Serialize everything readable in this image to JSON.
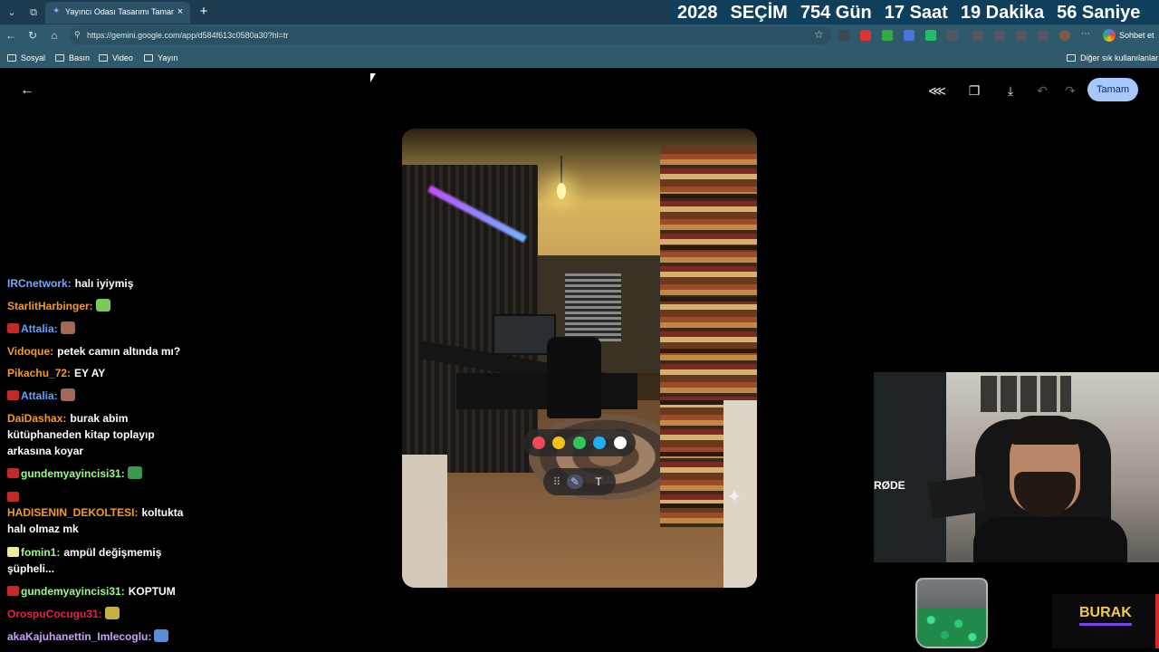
{
  "browser": {
    "tab_title": "Yayıncı Odası Tasarımı Tamamlandı",
    "url": "https://gemini.google.com/app/d584f613c0580a30?hl=tr",
    "chat_button_label": "Sohbet et",
    "bookmarks": [
      "Sosyal",
      "Basın",
      "Video",
      "Yayın"
    ],
    "other_bookmarks": "Diğer sık kullanılanlar"
  },
  "countdown": {
    "parts": [
      "2028",
      "SEÇİM",
      "754 Gün",
      "17 Saat",
      "19 Dakika",
      "56 Saniye"
    ],
    "background": "#103f5c"
  },
  "app": {
    "done_button": "Tamam",
    "done_color": "#a8c7fa",
    "icons": [
      "back-arrow-icon",
      "share-icon",
      "copy-icon",
      "download-icon",
      "undo-icon",
      "redo-icon"
    ]
  },
  "palette": {
    "colors": [
      "#f04a5a",
      "#f3c015",
      "#31c85a",
      "#1fb0ef",
      "#ffffff"
    ]
  },
  "tools": [
    "grid-handle-icon",
    "pen-icon",
    "text-icon"
  ],
  "tool_text_label": "T",
  "chat": [
    {
      "user": "IRCnetwork:",
      "color": "#79a9ff",
      "msg": "halı iyiymiş"
    },
    {
      "user": "StarlitHarbinger:",
      "color": "#f59a23",
      "msg": ""
    },
    {
      "user": "Attalia:",
      "color": "#5fa0ff",
      "msg": ""
    },
    {
      "user": "Vidoque:",
      "color": "#f59a23",
      "msg": "petek camın altında mı?"
    },
    {
      "user": "Pikachu_72:",
      "color": "#f59a23",
      "msg": "EY AY"
    },
    {
      "user": "Attalia:",
      "color": "#5fa0ff",
      "msg": ""
    },
    {
      "user": "DaiDashax:",
      "color": "#f59a23",
      "msg": "burak abim"
    },
    {
      "user": "",
      "color": "#ffffff",
      "msg": "kütüphaneden kitap toplayıp"
    },
    {
      "user": "",
      "color": "#ffffff",
      "msg": "arkasına koyar"
    },
    {
      "user": "gundemyayincisi31:",
      "color": "#9cfc8a",
      "msg": ""
    },
    {
      "user": "HADISENIN_DEKOLTESI:",
      "color": "#f59a23",
      "msg": "koltukta"
    },
    {
      "user": "",
      "color": "#ffffff",
      "msg": "halı olmaz mk"
    },
    {
      "user": "fomin1:",
      "color": "#9cfc8a",
      "msg": "ampül değişmemiş"
    },
    {
      "user": "",
      "color": "#ffffff",
      "msg": "şüpheli..."
    },
    {
      "user": "gundemyayincisi31:",
      "color": "#9cfc8a",
      "msg": "KOPTUM"
    },
    {
      "user": "OrospuCocugu31:",
      "color": "#e8204a",
      "msg": ""
    },
    {
      "user": "akaKajuhanettin_Imlecoglu:",
      "color": "#c9a2ff",
      "msg": ""
    }
  ],
  "webcam": {
    "mic_brand": "RØDE"
  },
  "streamer": {
    "name": "BURAK",
    "accent": "#f2c94c"
  }
}
